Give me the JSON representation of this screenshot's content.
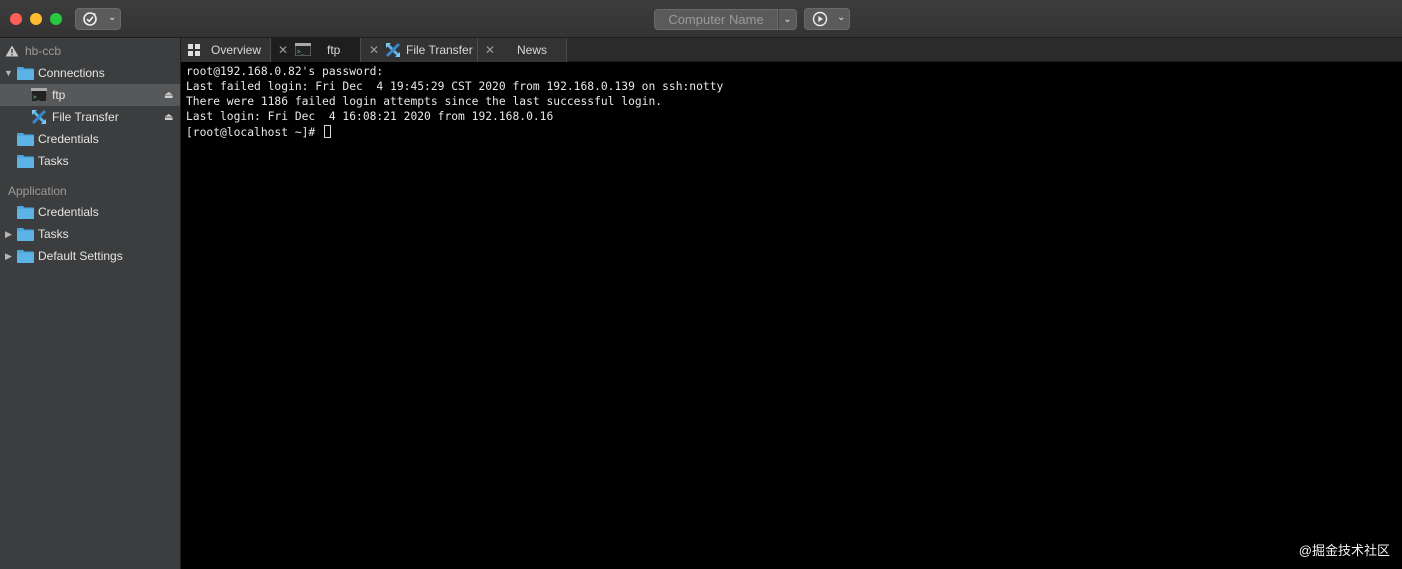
{
  "titlebar": {
    "computer_name_placeholder": "Computer Name"
  },
  "sidebar": {
    "workspace": "hb-ccb",
    "connections_label": "Connections",
    "connections_items": [
      {
        "label": "ftp",
        "icon": "terminal-icon"
      },
      {
        "label": "File Transfer",
        "icon": "file-transfer-icon"
      }
    ],
    "credentials_label": "Credentials",
    "tasks_label": "Tasks",
    "application_section": "Application",
    "application_items": [
      {
        "label": "Credentials",
        "expandable": false
      },
      {
        "label": "Tasks",
        "expandable": true
      },
      {
        "label": "Default Settings",
        "expandable": true
      }
    ]
  },
  "tabs": [
    {
      "label": "Overview",
      "icon": "grid-icon",
      "active": false
    },
    {
      "label": "ftp",
      "icon": "terminal-icon",
      "active": true
    },
    {
      "label": "File Transfer",
      "icon": "file-transfer-icon",
      "active": false
    },
    {
      "label": "News",
      "icon": "",
      "active": false
    }
  ],
  "terminal": {
    "lines": [
      "root@192.168.0.82's password:",
      "Last failed login: Fri Dec  4 19:45:29 CST 2020 from 192.168.0.139 on ssh:notty",
      "There were 1186 failed login attempts since the last successful login.",
      "Last login: Fri Dec  4 16:08:21 2020 from 192.168.0.16",
      "[root@localhost ~]# "
    ]
  },
  "watermark": "@掘金技术社区",
  "colors": {
    "folder": "#4ea6dc",
    "sidebar_bg": "#3c3d3e",
    "terminal_bg": "#000000"
  }
}
